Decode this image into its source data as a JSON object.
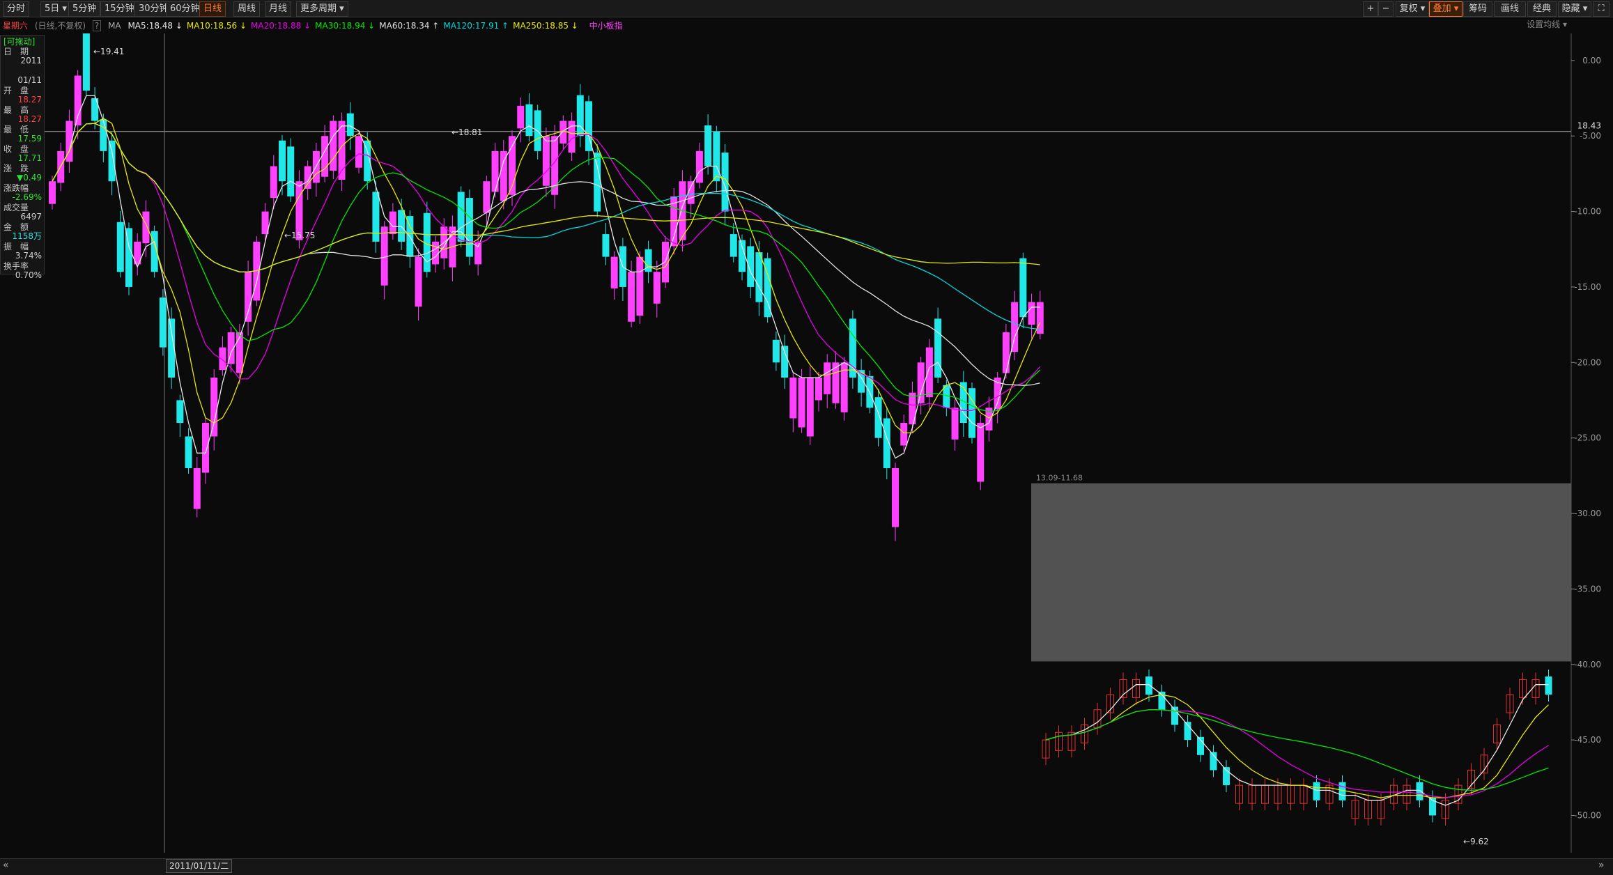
{
  "toolbar": {
    "tabs": [
      "分时",
      "5日",
      "5分钟",
      "15分钟",
      "30分钟",
      "60分钟",
      "日线",
      "周线",
      "月线",
      "更多周期"
    ],
    "active_tab": "日线",
    "right_buttons": [
      "+",
      "−",
      "复权",
      "叠加",
      "筹码",
      "画线",
      "经典",
      "隐藏"
    ],
    "active_right": "叠加",
    "fullscreen_icon": "fullscreen-icon"
  },
  "ma_bar": {
    "weekday": "星期六",
    "mode": "(日线,不复权)",
    "help": "?",
    "ma_label": "MA",
    "items": [
      {
        "text": "MA5:18.48",
        "arrow": "↓",
        "color": "#e8e8e8"
      },
      {
        "text": "MA10:18.56",
        "arrow": "↓",
        "color": "#e8e800"
      },
      {
        "text": "MA20:18.88",
        "arrow": "↓",
        "color": "#e800e8"
      },
      {
        "text": "MA30:18.94",
        "arrow": "↓",
        "color": "#00e800"
      },
      {
        "text": "MA60:18.34",
        "arrow": "↑",
        "color": "#e0e0e0"
      },
      {
        "text": "MA120:17.91",
        "arrow": "↑",
        "color": "#00d8d8"
      },
      {
        "text": "MA250:18.85",
        "arrow": "↓",
        "color": "#e8e800"
      }
    ],
    "index_label": "中小板指",
    "settings": "设置均线"
  },
  "info_panel": {
    "header": "[可拖动]",
    "rows": [
      {
        "label": "日　期",
        "value": "2011",
        "color": "#d0d0d0"
      },
      {
        "label": "",
        "value": "01/11",
        "color": "#d0d0d0"
      },
      {
        "label": "开　盘",
        "value": "18.27",
        "color": "#ff4040"
      },
      {
        "label": "最　高",
        "value": "18.27",
        "color": "#ff4040"
      },
      {
        "label": "最　低",
        "value": "17.59",
        "color": "#30e030"
      },
      {
        "label": "收　盘",
        "value": "17.71",
        "color": "#30e030"
      },
      {
        "label": "涨　跌",
        "value": "▼0.49",
        "color": "#30e030"
      },
      {
        "label": "涨跌幅",
        "value": "-2.69%",
        "color": "#30e030"
      },
      {
        "label": "成交量",
        "value": "6497",
        "color": "#d0d0d0"
      },
      {
        "label": "金　额",
        "value": "1158万",
        "color": "#30e0e0"
      },
      {
        "label": "振　幅",
        "value": "3.74%",
        "color": "#d0d0d0"
      },
      {
        "label": "换手率",
        "value": "0.70%",
        "color": "#d0d0d0"
      }
    ]
  },
  "cursor_date": "2011/01/11/二",
  "chart_data": {
    "type": "candlestick",
    "x_axis": "trading days (≈2010-08 to 2011-06)",
    "y_axis_right_ticks": [
      "0.00",
      "-5.00",
      "-10.00",
      "-15.00",
      "-20.00",
      "-25.00",
      "-30.00",
      "-35.00",
      "-40.00",
      "-45.00",
      "-50.00"
    ],
    "ylim": [
      -51.5,
      0.5
    ],
    "price_marker": "18.43",
    "hline_value": -4.7,
    "annotations": {
      "high": "19.41",
      "low": "15.75",
      "mid_high": "18.81",
      "gap_label": "13.09-11.68",
      "low2": "9.62"
    },
    "gap_zone": [
      -28.0,
      -39.8
    ],
    "series_main": {
      "bullish_color": "#ff40ff",
      "bearish_color": "#20e8e8",
      "up_color": "#e03030",
      "candles_y": [
        -8,
        -6,
        -4,
        -1,
        -2,
        -4,
        -6,
        -8,
        -14,
        -15,
        -12,
        -10,
        -14,
        -19,
        -21,
        -24,
        -27,
        -27,
        -24,
        -21,
        -19,
        -18,
        -18,
        -14,
        -12,
        -10,
        -7,
        -8,
        -9,
        -8,
        -7,
        -6,
        -5,
        -4,
        -4,
        -5,
        -5,
        -8,
        -12,
        -11,
        -10,
        -12,
        -13,
        -13,
        -14,
        -12,
        -11,
        -11,
        -12,
        -13,
        -12,
        -8,
        -6,
        -6,
        -5,
        -3,
        -5,
        -6,
        -5,
        -5,
        -4,
        -4,
        -5,
        -6,
        -10,
        -13,
        -13,
        -15,
        -14,
        -13,
        -14,
        -14,
        -12,
        -9,
        -8,
        -8,
        -6,
        -7,
        -8,
        -10,
        -13,
        -14,
        -15,
        -16,
        -17,
        -20,
        -21,
        -21,
        -21,
        -21,
        -21,
        -20,
        -20,
        -20,
        -21,
        -22,
        -23,
        -25,
        -27,
        -27,
        -24,
        -22,
        -20,
        -19,
        -21,
        -23,
        -23,
        -24,
        -25,
        -24,
        -23,
        -21,
        -18,
        -16,
        -17,
        -16,
        -16
      ]
    },
    "moving_averages": [
      "MA5",
      "MA10",
      "MA20",
      "MA30",
      "MA60",
      "MA120",
      "MA250"
    ]
  }
}
